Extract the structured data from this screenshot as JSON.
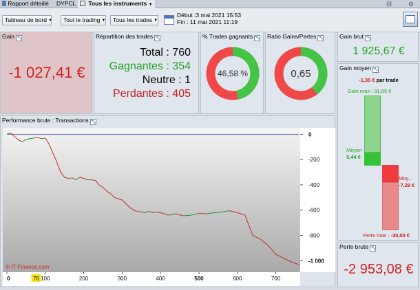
{
  "tabs": {
    "report": "Rapport détaillé",
    "symbol": "DYPCL",
    "instruments": "Tous les instruments"
  },
  "toolbar": {
    "dashboard": "Tableau de bord",
    "trading": "Tout le trading",
    "trades": "Tous les trades",
    "start_label": "Début :",
    "start_value": "3 mai 2021 15:53",
    "end_label": "Fin :",
    "end_value": "11 mai 2021 11:19"
  },
  "gain": {
    "title": "Gain",
    "value": "-1 027,41 €"
  },
  "repartition": {
    "title": "Répartition des trades",
    "total_label": "Total :",
    "total_value": "760",
    "winners_label": "Gagnantes :",
    "winners_value": "354",
    "neutral_label": "Neutre :",
    "neutral_value": "1",
    "losers_label": "Perdantes :",
    "losers_value": "405"
  },
  "win_pct": {
    "title": "% Trades gagnants",
    "value": "46,58 %",
    "fraction": 0.4658
  },
  "ratio": {
    "title": "Ratio Gains/Pertes",
    "value": "0,65",
    "fraction": 0.394
  },
  "gross_gain": {
    "title": "Gain brut",
    "value": "1 925,67 €"
  },
  "avg_gain": {
    "title": "Gain moyen",
    "per_trade_value": "-1,35 €",
    "per_trade_label": "par trade",
    "gain_max_label": "Gain max :",
    "gain_max_value": "31,65 €",
    "avg_label": "Moyen",
    "avg_value": "5,44 €",
    "loss_avg_label": "Moy...",
    "loss_avg_value": "-7,29 €",
    "loss_max_label": "Perte max :",
    "loss_max_value": "-30,00 €"
  },
  "gross_loss": {
    "title": "Perte brute",
    "value": "-2 953,08 €"
  },
  "performance": {
    "title": "Performance brute : Transactions",
    "watermark": "© IT-Finance.com",
    "marker": "76"
  },
  "colors": {
    "green": "#27a327",
    "red": "#d42020",
    "win_ring": "#44c444",
    "loss_ring": "#f04848"
  },
  "chart_data": {
    "type": "line",
    "title": "Performance brute : Transactions",
    "xlabel": "",
    "ylabel": "",
    "xlim": [
      0,
      760
    ],
    "ylim": [
      -1080,
      40
    ],
    "x_ticks": [
      "0",
      "100",
      "200",
      "300",
      "400",
      "500",
      "600",
      "700"
    ],
    "y_ticks": [
      "0",
      "-200",
      "-400",
      "-600",
      "-800",
      "-1 000"
    ],
    "series": [
      {
        "x": [
          0,
          10,
          20,
          30,
          40,
          50,
          60,
          70,
          80,
          90,
          100,
          110,
          120,
          130,
          140,
          150,
          160,
          170,
          180,
          190,
          200,
          210,
          220,
          230,
          240,
          250,
          260,
          270,
          280,
          290,
          300,
          310,
          320,
          330,
          340,
          350,
          360,
          370,
          380,
          390,
          400,
          420,
          440,
          460,
          480,
          500,
          520,
          540,
          560,
          580,
          600,
          620,
          640,
          660,
          680,
          700,
          720,
          740,
          760
        ],
        "y": [
          0,
          10,
          -20,
          -45,
          -60,
          -40,
          -35,
          -30,
          -25,
          -35,
          -30,
          -80,
          -150,
          -220,
          -300,
          -340,
          -350,
          -345,
          -360,
          -340,
          -350,
          -360,
          -360,
          -365,
          -400,
          -420,
          -450,
          -470,
          -500,
          -510,
          -520,
          -550,
          -580,
          -600,
          -610,
          -615,
          -620,
          -610,
          -620,
          -615,
          -620,
          -640,
          -630,
          -645,
          -640,
          -625,
          -630,
          -620,
          -615,
          -605,
          -620,
          -640,
          -800,
          -830,
          -880,
          -950,
          -980,
          -1010,
          -1030
        ]
      }
    ]
  }
}
